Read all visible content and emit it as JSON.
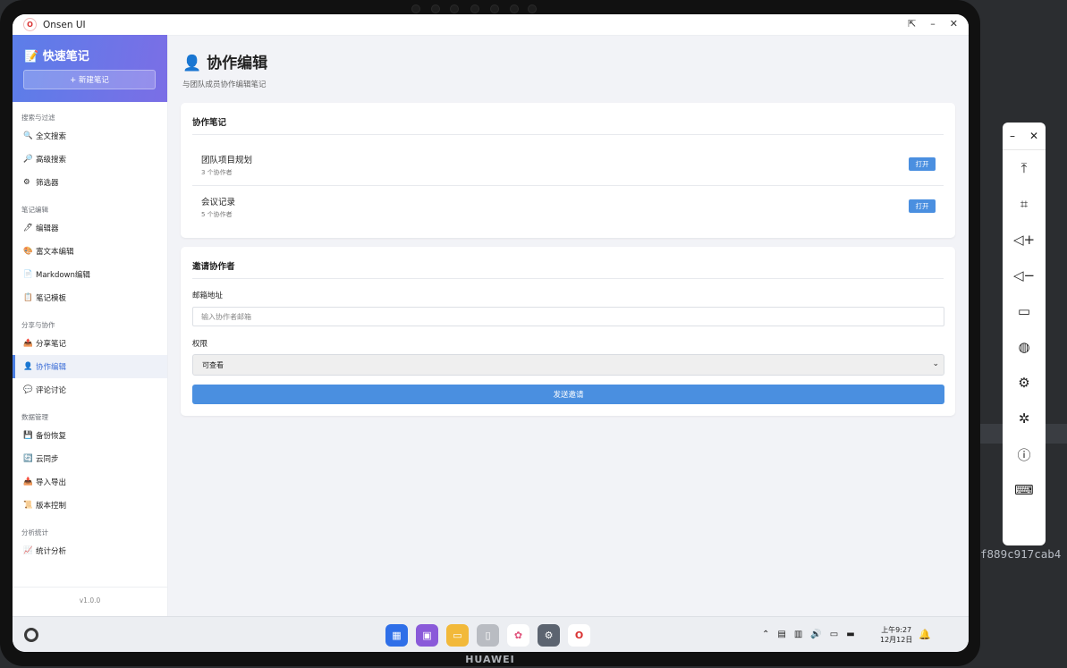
{
  "window": {
    "title": "Onsen UI",
    "controls": [
      "⇱",
      "–",
      "✕"
    ]
  },
  "sidebar": {
    "app_title": "📝 快速笔记",
    "new_note_label": "+ 新建笔记",
    "sections": [
      {
        "title": "搜索与过滤",
        "items": [
          {
            "icon": "🔍",
            "label": "全文搜索"
          },
          {
            "icon": "🔎",
            "label": "高级搜索"
          },
          {
            "icon": "⚙",
            "label": "筛选器"
          }
        ]
      },
      {
        "title": "笔记编辑",
        "items": [
          {
            "icon": "🖊",
            "label": "编辑器"
          },
          {
            "icon": "🎨",
            "label": "富文本编辑"
          },
          {
            "icon": "📄",
            "label": "Markdown编辑"
          },
          {
            "icon": "📋",
            "label": "笔记模板"
          }
        ]
      },
      {
        "title": "分享与协作",
        "items": [
          {
            "icon": "📤",
            "label": "分享笔记"
          },
          {
            "icon": "👤",
            "label": "协作编辑",
            "active": true
          },
          {
            "icon": "💬",
            "label": "评论讨论"
          }
        ]
      },
      {
        "title": "数据管理",
        "items": [
          {
            "icon": "💾",
            "label": "备份恢复"
          },
          {
            "icon": "🔄",
            "label": "云同步"
          },
          {
            "icon": "📥",
            "label": "导入导出"
          },
          {
            "icon": "📜",
            "label": "版本控制"
          }
        ]
      },
      {
        "title": "分析统计",
        "items": [
          {
            "icon": "📈",
            "label": "统计分析"
          }
        ]
      }
    ],
    "version": "v1.0.0"
  },
  "main": {
    "title": "👤 协作编辑",
    "subtitle": "与团队成员协作编辑笔记",
    "notes_card": {
      "title": "协作笔记",
      "notes": [
        {
          "name": "团队项目规划",
          "meta": "3 个协作者",
          "action": "打开"
        },
        {
          "name": "会议记录",
          "meta": "5 个协作者",
          "action": "打开"
        }
      ]
    },
    "invite_card": {
      "title": "邀请协作者",
      "email_label": "邮箱地址",
      "email_placeholder": "输入协作者邮箱",
      "permission_label": "权限",
      "permission_value": "可查看",
      "submit_label": "发送邀请"
    }
  },
  "taskbar": {
    "clock_time": "上午9:27",
    "clock_date": "12月12日"
  },
  "device": {
    "brand": "HUAWEI"
  },
  "background": {
    "hash_text": "f889c917cab4"
  },
  "colors": {
    "accent": "#4a8fe0",
    "header_gradient_start": "#5b7ee9",
    "header_gradient_end": "#7b6ee6"
  }
}
